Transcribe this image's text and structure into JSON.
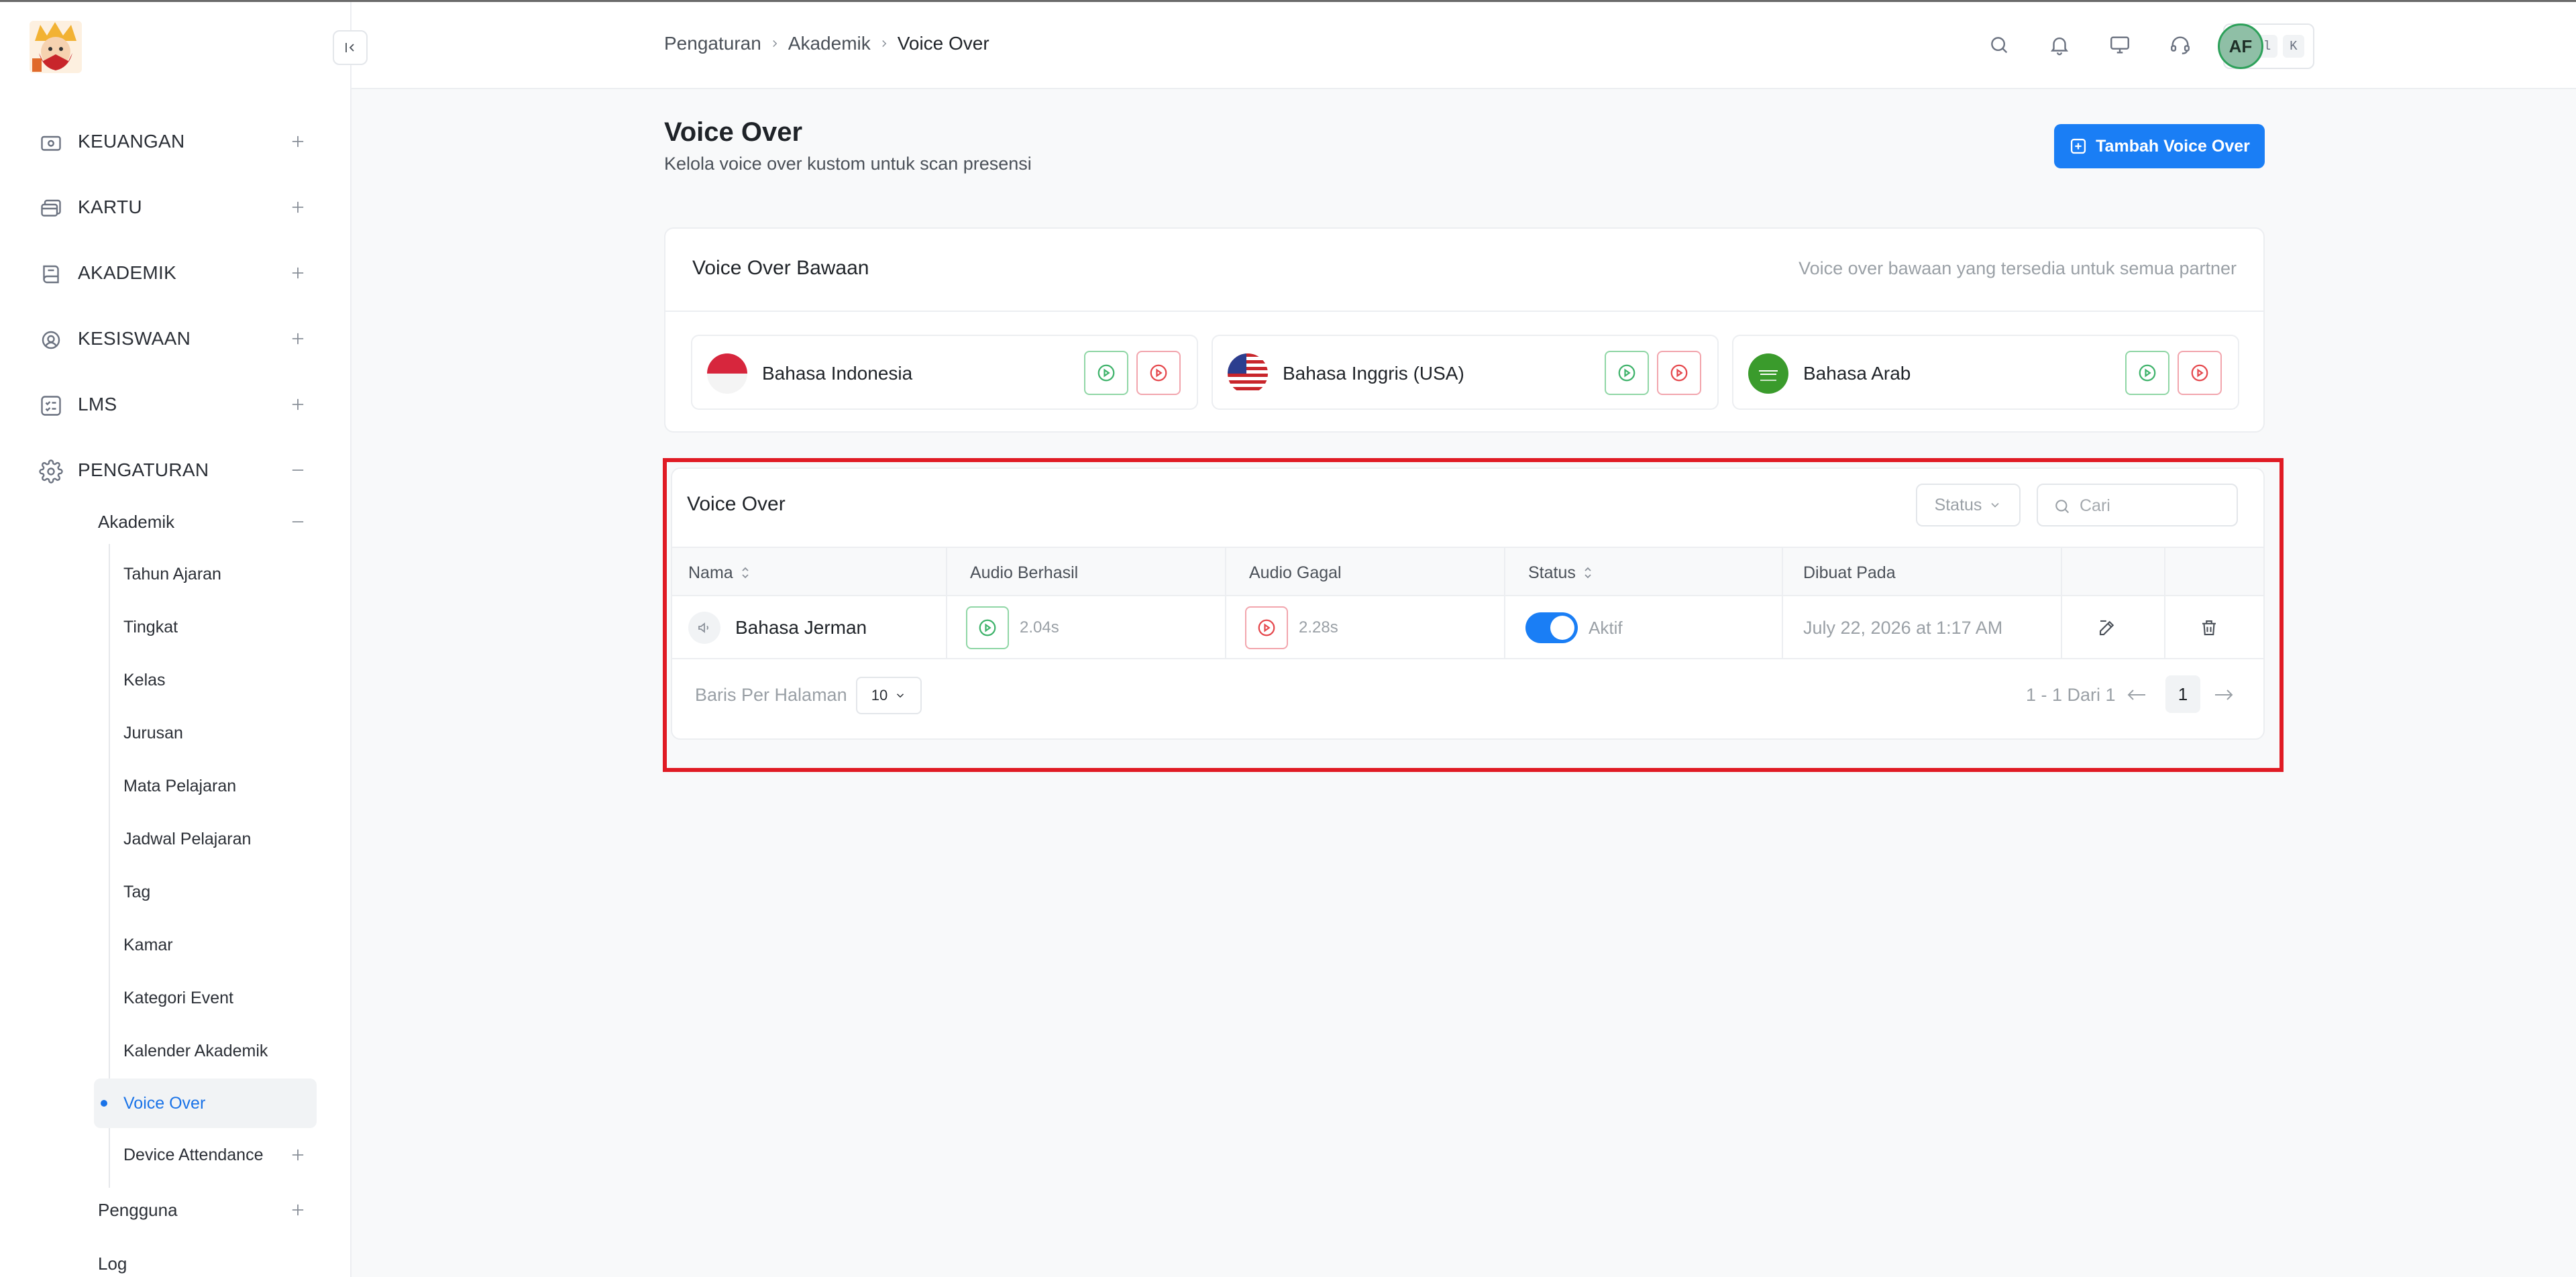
{
  "sidebar": {
    "items": [
      {
        "label": "KEUANGAN",
        "icon": "wallet-icon"
      },
      {
        "label": "KARTU",
        "icon": "cards-icon"
      },
      {
        "label": "AKADEMIK",
        "icon": "book-icon"
      },
      {
        "label": "KESISWAAN",
        "icon": "student-icon"
      },
      {
        "label": "LMS",
        "icon": "list-check-icon"
      },
      {
        "label": "PENGATURAN",
        "icon": "gear-icon"
      }
    ],
    "sub_groups": [
      "Akademik",
      "Pengguna"
    ],
    "akademik_items": [
      "Tahun Ajaran",
      "Tingkat",
      "Kelas",
      "Jurusan",
      "Mata Pelajaran",
      "Jadwal Pelajaran",
      "Tag",
      "Kamar",
      "Kategori Event",
      "Kalender Akademik",
      "Voice Over",
      "Device Attendance"
    ],
    "truncated_item": "Log"
  },
  "header": {
    "breadcrumb": [
      "Pengaturan",
      "Akademik",
      "Voice Over"
    ],
    "kbd_ctrl": "Ctrl",
    "kbd_k": "K",
    "avatar_initials": "AF"
  },
  "page": {
    "title": "Voice Over",
    "subtitle": "Kelola voice over kustom untuk scan presensi",
    "add_button": "Tambah Voice Over"
  },
  "default_card": {
    "title": "Voice Over Bawaan",
    "description": "Voice over bawaan yang tersedia untuk semua partner",
    "languages": [
      {
        "name": "Bahasa Indonesia",
        "flag": "indonesia-flag"
      },
      {
        "name": "Bahasa Inggris (USA)",
        "flag": "usa-flag"
      },
      {
        "name": "Bahasa Arab",
        "flag": "saudi-flag"
      }
    ]
  },
  "table_card": {
    "title": "Voice Over",
    "status_filter": "Status",
    "search_placeholder": "Cari",
    "columns": [
      "Nama",
      "Audio Berhasil",
      "Audio Gagal",
      "Status",
      "Dibuat Pada"
    ],
    "rows": [
      {
        "name": "Bahasa Jerman",
        "success_duration": "2.04s",
        "fail_duration": "2.28s",
        "status": "Aktif",
        "active": true,
        "created_at": "July 22, 2026 at 1:17 AM"
      }
    ],
    "footer": {
      "rows_per_page_label": "Baris Per Halaman",
      "rows_per_page_value": "10",
      "page_info": "1 - 1 Dari 1",
      "current_page": "1"
    }
  },
  "colors": {
    "accent": "#1a7ef5",
    "success": "#2da15a",
    "danger": "#e5484d",
    "highlight": "#e01b24"
  }
}
